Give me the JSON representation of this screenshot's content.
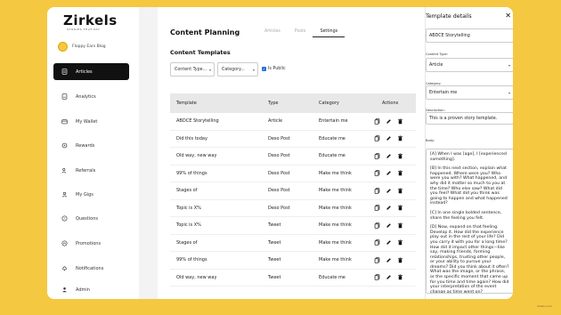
{
  "brand": {
    "logo": "Zirkels",
    "tagline": "STORIES THAT PAY"
  },
  "blog": {
    "name": "Floppy Ears Blog"
  },
  "nav": [
    {
      "label": "Articles",
      "icon": "article-icon",
      "active": true
    },
    {
      "label": "Analytics",
      "icon": "analytics-icon"
    },
    {
      "label": "My Wallet",
      "icon": "wallet-icon"
    },
    {
      "label": "Rewards",
      "icon": "rewards-icon"
    },
    {
      "label": "Referrals",
      "icon": "referrals-icon"
    },
    {
      "label": "My Gigs",
      "icon": "gigs-icon"
    },
    {
      "label": "Questions",
      "icon": "questions-icon"
    },
    {
      "label": "Promotions",
      "icon": "promotions-icon"
    },
    {
      "label": "Notifications",
      "icon": "notifications-icon"
    },
    {
      "label": "Admin",
      "icon": "admin-icon"
    }
  ],
  "main": {
    "title": "Content Planning",
    "tabs": [
      {
        "label": "Articles",
        "active": false
      },
      {
        "label": "Posts",
        "active": false
      },
      {
        "label": "Settings",
        "active": true
      }
    ],
    "subtitle": "Content Templates",
    "filters": {
      "content_type": "Content Type...",
      "category": "Category...",
      "is_public_label": "Is Public"
    },
    "table": {
      "headers": [
        "Template",
        "Type",
        "Category",
        "Actions"
      ],
      "rows": [
        [
          "ABDCE Storytelling",
          "Article",
          "Entertain me"
        ],
        [
          "Did this today",
          "Deso Post",
          "Educate me"
        ],
        [
          "Old way, new way",
          "Deso Post",
          "Educate me"
        ],
        [
          "99% of things",
          "Deso Post",
          "Make me think"
        ],
        [
          "Stages of",
          "Deso Post",
          "Make me think"
        ],
        [
          "Topic is X%",
          "Deso Post",
          "Make me think"
        ],
        [
          "Topic is X%",
          "Tweet",
          "Make me think"
        ],
        [
          "Stages of",
          "Tweet",
          "Make me think"
        ],
        [
          "99% of things",
          "Tweet",
          "Make me think"
        ],
        [
          "Old way, new way",
          "Tweet",
          "Educate me"
        ]
      ]
    }
  },
  "details": {
    "title": "Template details",
    "name_value": "ABDCE Storytelling",
    "content_type_label": "Content Type:",
    "content_type_value": "Article",
    "category_label": "Category:",
    "category_value": "Entertain me",
    "description_label": "Description:",
    "description_value": "This is a proven story template.",
    "body_label": "Body:",
    "body_paragraphs": [
      "[A] When I was [age], I [experienced something].",
      "[B] In this next section, explain what happened. Where were you? Who were you with? What happened, and why did it matter so much to you at the time? Who else saw? What did you feel? What did you think was going to happen and what happened instead?",
      "[C] In one single bolded sentence, share the feeling you felt.",
      "[D] Now, expand on that feeling. Develop it. How did the experience play out in the rest of your life? Did you carry it with you for a long time? How did it impact other things—like say, making friends, forming relationships, trusting other people, or your ability to pursue your dreams? Did you think about it often? What was the image, or the phrase, or the specific moment that came up for you time and time again? How did your interpretation of the event change as time went on?"
    ]
  },
  "footer": {
    "corner_text": "zirkels.com"
  }
}
